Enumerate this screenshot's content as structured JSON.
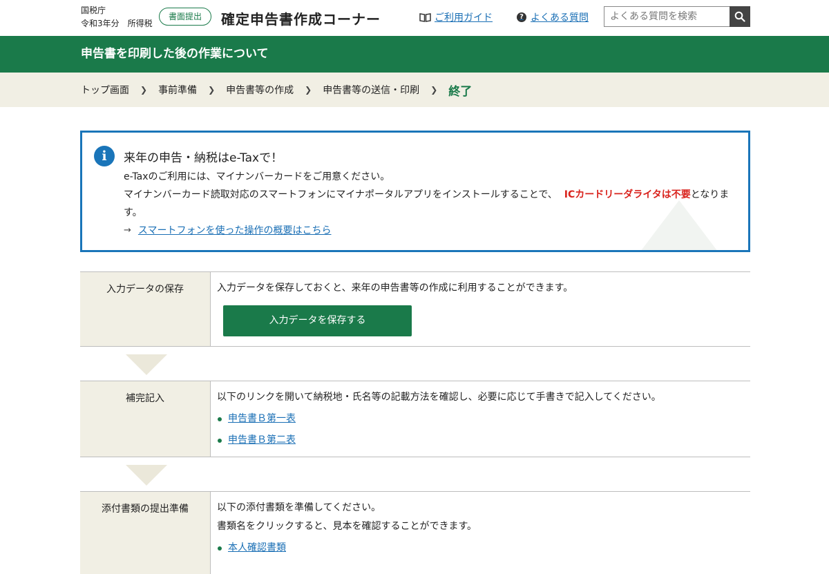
{
  "header": {
    "agency": "国税庁",
    "year": "令和3年分",
    "tax_type": "所得税",
    "mode_badge": "書面提出",
    "app_title": "確定申告書作成コーナー",
    "guide_link": "ご利用ガイド",
    "faq_link": "よくある質問",
    "search_placeholder": "よくある質問を検索"
  },
  "page_title": "申告書を印刷した後の作業について",
  "breadcrumb": {
    "items": [
      "トップ画面",
      "事前準備",
      "申告書等の作成",
      "申告書等の送信・印刷"
    ],
    "current": "終了"
  },
  "notice": {
    "title": "来年の申告・納税はe-Taxで！",
    "line1": "e-Taxのご利用には、マイナンバーカードをご用意ください。",
    "line2_pre": "マイナンバーカード読取対応のスマートフォンにマイナポータルアプリをインストールすることで、",
    "line2_red": "ICカードリーダライタは不要",
    "line2_post": "となりま",
    "line3": "す。",
    "link": "スマートフォンを使った操作の概要はこちら"
  },
  "steps": {
    "save": {
      "label": "入力データの保存",
      "text": "入力データを保存しておくと、来年の申告書等の作成に利用することができます。",
      "button": "入力データを保存する"
    },
    "supplement": {
      "label": "補完記入",
      "text": "以下のリンクを開いて納税地・氏名等の記載方法を確認し、必要に応じて手書きで記入してください。",
      "links": [
        "申告書Ｂ第一表",
        "申告書Ｂ第二表"
      ]
    },
    "attach": {
      "label": "添付書類の提出準備",
      "text1": "以下の添付書類を準備してください。",
      "text2": "書類名をクリックすると、見本を確認することができます。",
      "links": [
        "本人確認書類"
      ]
    }
  },
  "colors": {
    "brand_green": "#1a7a4a",
    "link_blue": "#1a6fb5",
    "notice_border": "#1a75b9",
    "alert_red": "#d9231d",
    "beige": "#f1efe4"
  }
}
